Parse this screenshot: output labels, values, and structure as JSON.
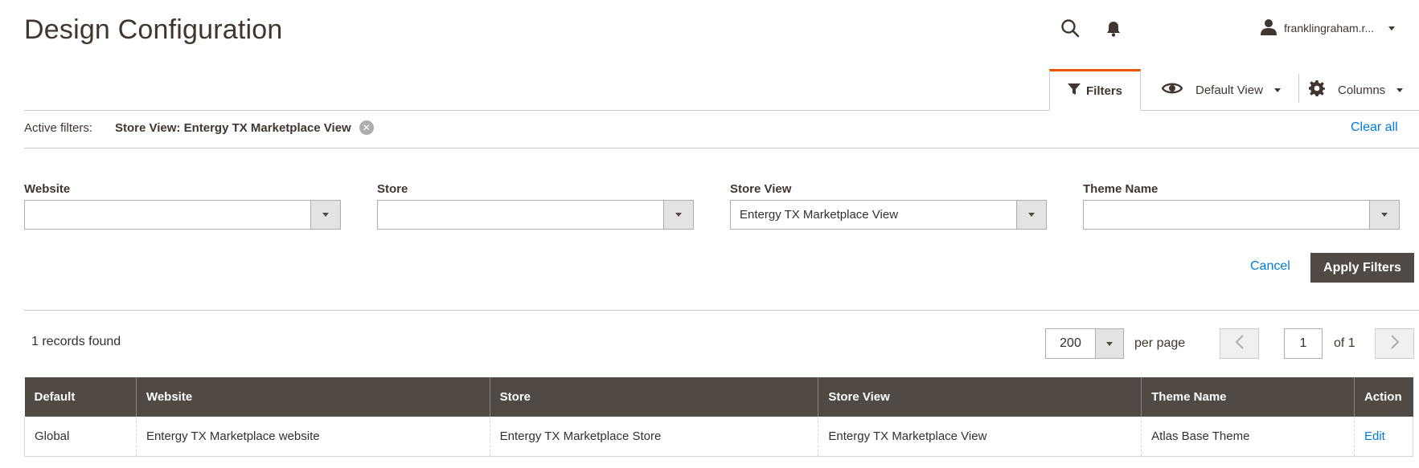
{
  "header": {
    "title": "Design Configuration",
    "user_name": "franklingraham.r..."
  },
  "toolbar": {
    "filters_label": "Filters",
    "view_label": "Default View",
    "columns_label": "Columns"
  },
  "active_filters": {
    "label": "Active filters:",
    "chips": [
      "Store View: Entergy TX Marketplace View"
    ],
    "clear_all": "Clear all"
  },
  "filters": {
    "website": {
      "label": "Website",
      "value": ""
    },
    "store": {
      "label": "Store",
      "value": ""
    },
    "store_view": {
      "label": "Store View",
      "value": "Entergy TX Marketplace View"
    },
    "theme_name": {
      "label": "Theme Name",
      "value": ""
    },
    "cancel": "Cancel",
    "apply": "Apply Filters"
  },
  "pager": {
    "records": "1 records found",
    "per_page_value": "200",
    "per_page_label": "per page",
    "current_page": "1",
    "of_label": "of 1"
  },
  "table": {
    "columns": [
      "Default",
      "Website",
      "Store",
      "Store View",
      "Theme Name",
      "Action"
    ],
    "rows": [
      {
        "default": "Global",
        "website": "Entergy TX Marketplace website",
        "store": "Entergy TX Marketplace Store",
        "store_view": "Entergy TX Marketplace View",
        "theme_name": "Atlas Base Theme",
        "action": "Edit"
      }
    ]
  },
  "colors": {
    "accent_tab": "#eb5202",
    "header_bg": "#514943",
    "link": "#007bdb"
  }
}
